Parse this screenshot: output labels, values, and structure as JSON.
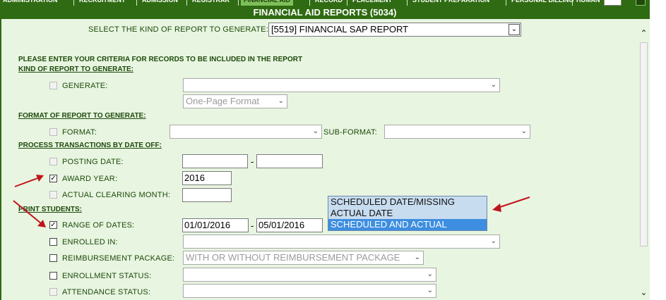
{
  "topnav": {
    "tabs": [
      "ADMINISTRATION",
      "RECRUITMENT",
      "ADMISSION",
      "REGISTRAR",
      "FINANCIAL AID",
      "RECORD",
      "PLACEMENT",
      "STUDENT PREPARATION",
      "PERSONAL BILLING",
      "HUMAN"
    ],
    "active_tab": "FINANCIAL AID"
  },
  "header": {
    "title": "FINANCIAL AID REPORTS (5034)"
  },
  "report_select": {
    "label": "SELECT THE KIND OF REPORT TO GENERATE:",
    "value": "[5519] FINANCIAL SAP REPORT"
  },
  "criteria": {
    "intro": "PLEASE ENTER YOUR CRITERIA FOR RECORDS TO BE INCLUDED IN THE REPORT"
  },
  "sections": {
    "kind": "KIND OF REPORT TO GENERATE:",
    "format": "FORMAT OF REPORT TO GENERATE:",
    "process": "PROCESS TRANSACTIONS BY DATE OFF:",
    "print": "PRINT STUDENTS:"
  },
  "generate": {
    "label": "GENERATE:",
    "value": "",
    "format_option": "One-Page Format",
    "checked": false,
    "enabled": false
  },
  "format": {
    "label": "FORMAT:",
    "value": "",
    "subformat_label": "SUB-FORMAT:",
    "subformat_value": "",
    "checked": false,
    "enabled": false
  },
  "posting_date": {
    "label": "POSTING DATE:",
    "from": "",
    "to": "",
    "separator": "-",
    "checked": false,
    "enabled": false
  },
  "award_year": {
    "label": "AWARD YEAR:",
    "value": "2016",
    "checked": true,
    "enabled": true
  },
  "actual_clearing_month": {
    "label": "ACTUAL CLEARING MONTH:",
    "value": "",
    "checked": false,
    "enabled": false
  },
  "range_of_dates": {
    "label": "RANGE OF DATES:",
    "from": "01/01/2016",
    "to": "05/01/2016",
    "separator": "-",
    "checked": true,
    "enabled": true
  },
  "date_type_options": {
    "options": [
      "SCHEDULED DATE/MISSING",
      "ACTUAL DATE",
      "SCHEDULED AND ACTUAL"
    ],
    "selected": "SCHEDULED AND ACTUAL"
  },
  "enrolled_in": {
    "label": "ENROLLED IN:",
    "value": "",
    "checked": false,
    "enabled": true
  },
  "reimbursement_package": {
    "label": "REIMBURSEMENT PACKAGE:",
    "value": "WITH OR WITHOUT REIMBURSEMENT PACKAGE",
    "checked": false,
    "enabled": true
  },
  "enrollment_status": {
    "label": "ENROLLMENT STATUS:",
    "value": "",
    "checked": false,
    "enabled": true
  },
  "attendance_status": {
    "label": "ATTENDANCE STATUS:",
    "value": "",
    "checked": false,
    "enabled": false
  },
  "colors": {
    "header_green": "#2f6b12",
    "panel_bg": "#e8f5e1",
    "label_green": "#1d4a0a",
    "selection_blue": "#3d8ee0",
    "option_bg": "#c8dcf0",
    "annotation_red": "#c0141b"
  },
  "icons": {
    "dropdown": "chevron-down-icon",
    "checkmark": "check-icon",
    "scroll_up": "chevron-up-icon",
    "scroll_down": "chevron-down-icon",
    "annotation": "red-arrow-icon"
  }
}
